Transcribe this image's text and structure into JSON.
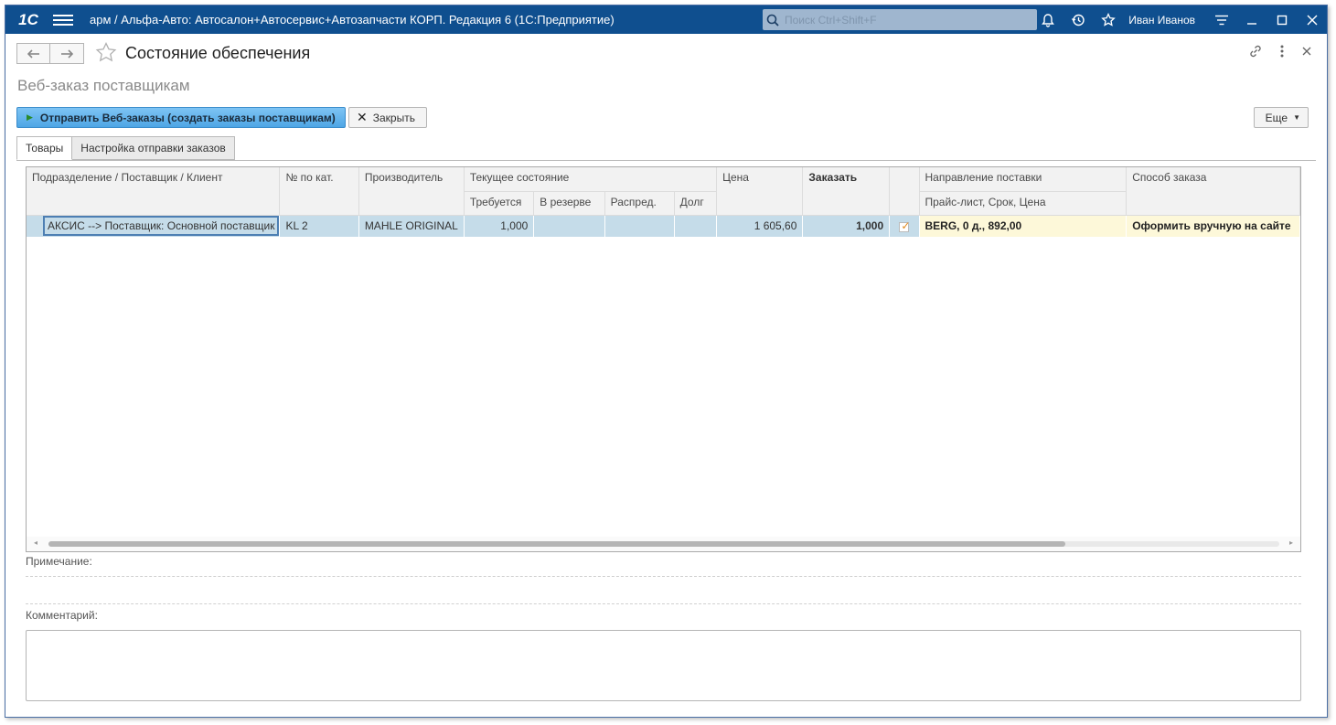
{
  "titlebar": {
    "logo": "1С",
    "app_title": "арм / Альфа-Авто: Автосалон+Автосервис+Автозапчасти КОРП. Редакция 6  (1С:Предприятие)",
    "search_placeholder": "Поиск Ctrl+Shift+F",
    "username": "Иван Иванов"
  },
  "header": {
    "title": "Состояние обеспечения",
    "subtitle": "Веб-заказ поставщикам"
  },
  "commands": {
    "send_label": "Отправить Веб-заказы (создать заказы поставщикам)",
    "close_label": "Закрыть",
    "more_label": "Еще"
  },
  "tabs": [
    {
      "label": "Товары",
      "active": true
    },
    {
      "label": "Настройка отправки заказов",
      "active": false
    }
  ],
  "grid": {
    "headers": {
      "division": "Подразделение / Поставщик / Клиент",
      "catalog_no": "№ по кат.",
      "manufacturer": "Производитель",
      "current_state": "Текущее состояние",
      "required": "Требуется",
      "reserved": "В резерве",
      "distributed": "Распред.",
      "debt": "Долг",
      "price": "Цена",
      "order": "Заказать",
      "direction": "Направление поставки",
      "pricelist": "Прайс-лист, Срок, Цена",
      "method": "Способ заказа"
    },
    "rows": [
      {
        "division": "АКСИС --> Поставщик: Основной поставщик",
        "catalog_no": "KL 2",
        "manufacturer": "MAHLE ORIGINAL",
        "required": "1,000",
        "reserved": "",
        "distributed": "",
        "debt": "",
        "price": "1 605,60",
        "order": "1,000",
        "checked": true,
        "pricelist": "BERG, 0 д., 892,00",
        "method": "Оформить вручную на сайте"
      }
    ]
  },
  "note_label": "Примечание:",
  "comment_label": "Комментарий:"
}
